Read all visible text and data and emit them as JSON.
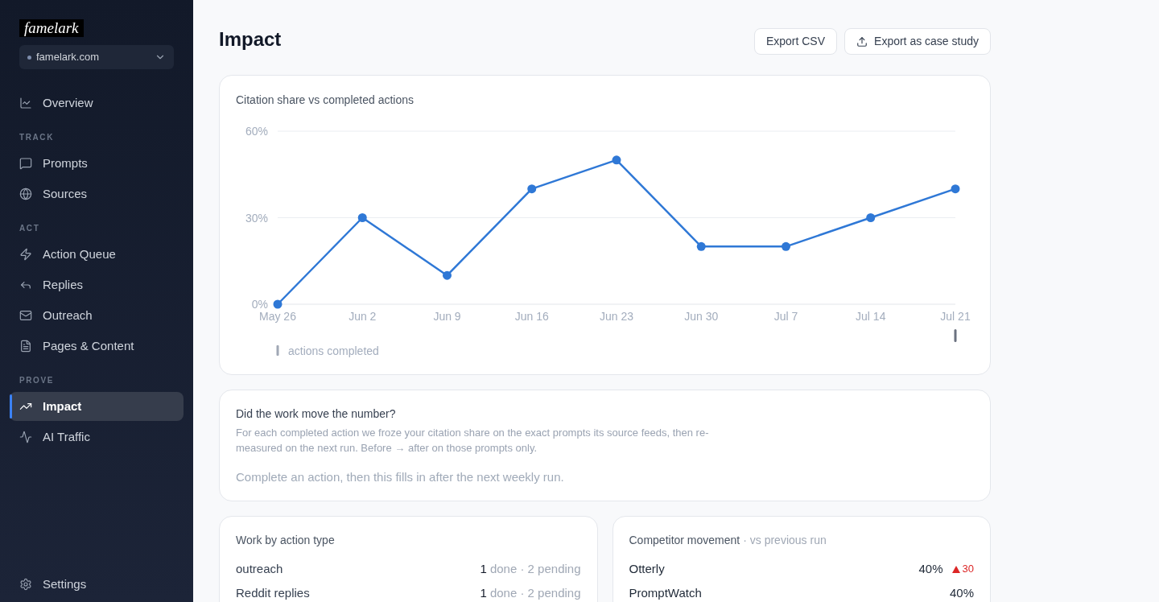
{
  "sidebar": {
    "logo": "famelark",
    "site_selector": {
      "value": "famelark.com"
    },
    "sections": [
      {
        "items": [
          {
            "label": "Overview",
            "selected": false
          }
        ]
      },
      {
        "heading": "TRACK",
        "items": [
          {
            "label": "Prompts",
            "selected": false
          },
          {
            "label": "Sources",
            "selected": false
          }
        ]
      },
      {
        "heading": "ACT",
        "items": [
          {
            "label": "Action Queue",
            "selected": false
          },
          {
            "label": "Replies",
            "selected": false
          },
          {
            "label": "Outreach",
            "selected": false
          },
          {
            "label": "Pages & Content",
            "selected": false
          }
        ]
      },
      {
        "heading": "PROVE",
        "items": [
          {
            "label": "Impact",
            "selected": true
          },
          {
            "label": "AI Traffic",
            "selected": false
          }
        ]
      }
    ],
    "footer_items": [
      {
        "label": "Settings",
        "selected": false
      }
    ]
  },
  "header": {
    "title": "Impact",
    "buttons": [
      {
        "label": "Export CSV",
        "kind": "text"
      },
      {
        "label": "Export as case study",
        "kind": "icon_text"
      }
    ]
  },
  "citation_chart": {
    "chart_data": {
      "type": "line",
      "title": "Citation share vs completed actions",
      "categories": [
        "May 26",
        "Jun 2",
        "Jun 9",
        "Jun 16",
        "Jun 23",
        "Jun 30",
        "Jul 7",
        "Jul 14",
        "Jul 21"
      ],
      "series": [
        {
          "color": "#2f78d6",
          "marker": "circle",
          "values": [
            0,
            30,
            10,
            40,
            50,
            20,
            20,
            30,
            40
          ]
        }
      ],
      "ylim": [
        0,
        60
      ],
      "yticks": [
        {
          "value": 0,
          "label": "0%"
        },
        {
          "value": 30,
          "label": "30%"
        },
        {
          "value": 60,
          "label": "60%"
        }
      ]
    },
    "actions_completed": {
      "label": "actions completed",
      "weeks": [
        {
          "done": false
        },
        {
          "done": false
        },
        {
          "done": false
        },
        {
          "done": false
        },
        {
          "done": false
        },
        {
          "done": false
        },
        {
          "done": false
        },
        {
          "done": false
        },
        {
          "done": true
        }
      ]
    }
  },
  "work_evidence": {
    "title": "Did the work move the number?",
    "description": "For each completed action we froze your citation share on the exact prompts its source feeds, then re-measured on the next run. Before → after on those prompts only.",
    "empty_message": "Complete an action, then this fills in after the next weekly run."
  },
  "work_by_action_type": {
    "title": "Work by action type",
    "rows": [
      {
        "type": "outreach",
        "summary": "**1** done · 2 pending"
      },
      {
        "type": "Reddit replies",
        "summary": "**1** done · 2 pending"
      }
    ]
  },
  "competitor_movement": {
    "title": "Competitor movement",
    "subtitle": "· vs previous run",
    "rows": [
      {
        "name": "Otterly",
        "share": "40%",
        "rising": true,
        "change": "30"
      },
      {
        "name": "PromptWatch",
        "share": "40%"
      }
    ]
  }
}
